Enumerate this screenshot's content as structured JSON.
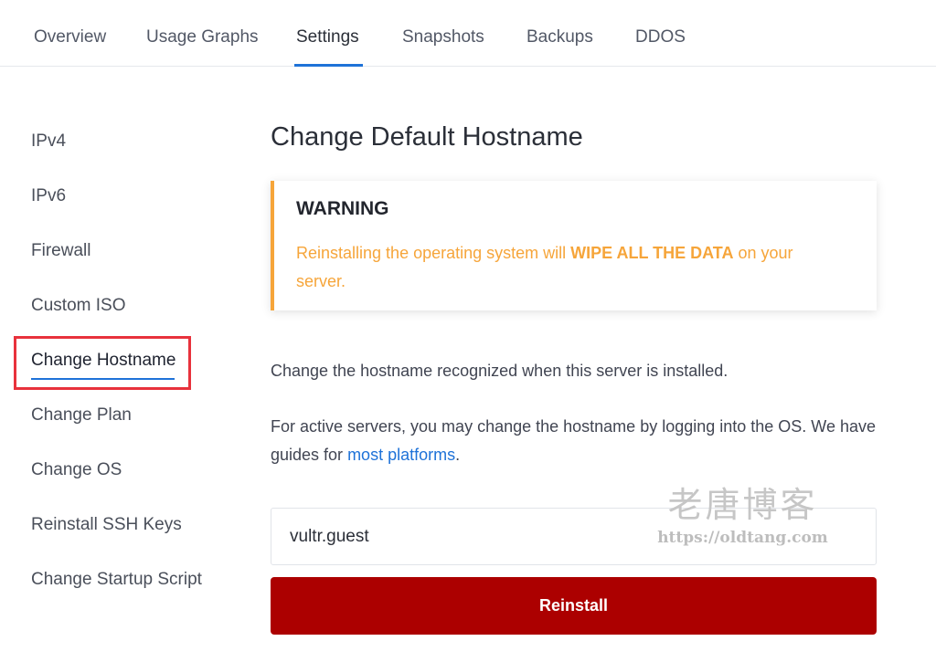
{
  "tabs": [
    {
      "label": "Overview"
    },
    {
      "label": "Usage Graphs"
    },
    {
      "label": "Settings",
      "active": true
    },
    {
      "label": "Snapshots"
    },
    {
      "label": "Backups"
    },
    {
      "label": "DDOS"
    }
  ],
  "sidebar": {
    "items": [
      {
        "label": "IPv4"
      },
      {
        "label": "IPv6"
      },
      {
        "label": "Firewall"
      },
      {
        "label": "Custom ISO"
      },
      {
        "label": "Change Hostname",
        "active": true
      },
      {
        "label": "Change Plan"
      },
      {
        "label": "Change OS"
      },
      {
        "label": "Reinstall SSH Keys"
      },
      {
        "label": "Change Startup Script"
      }
    ]
  },
  "main": {
    "title": "Change Default Hostname",
    "warning": {
      "title": "WARNING",
      "text_before": "Reinstalling the operating system will ",
      "text_bold": "WIPE ALL THE DATA",
      "text_after": " on your server."
    },
    "description_1": "Change the hostname recognized when this server is installed.",
    "description_2_before": "For active servers, you may change the hostname by logging into the OS. We have guides for ",
    "description_2_link": "most platforms",
    "description_2_after": ".",
    "hostname_value": "vultr.guest",
    "reinstall_label": "Reinstall"
  },
  "watermark": {
    "title": "老唐博客",
    "url": "https://oldtang.com"
  },
  "colors": {
    "accent": "#1e72d8",
    "warning": "#f6a53a",
    "danger": "#ac0000",
    "highlight_box": "#e8323c"
  }
}
